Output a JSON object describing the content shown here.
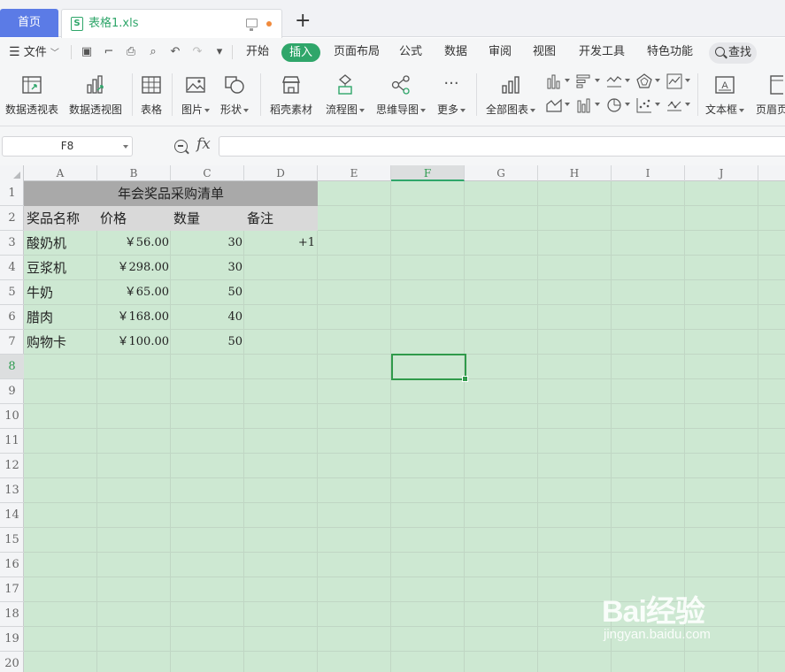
{
  "tabs": {
    "home": "首页",
    "file": "表格1.xls"
  },
  "menu": {
    "file": "文件",
    "items": [
      "开始",
      "插入",
      "页面布局",
      "公式",
      "数据",
      "审阅",
      "视图",
      "开发工具",
      "特色功能"
    ],
    "active": "插入",
    "search": "查找"
  },
  "ribbon": {
    "pivot_table": "数据透视表",
    "pivot_chart": "数据透视图",
    "table": "表格",
    "picture": "图片",
    "shape": "形状",
    "material": "稻壳素材",
    "flowchart": "流程图",
    "mindmap": "思维导图",
    "more": "更多",
    "all_charts": "全部图表",
    "textbox": "文本框",
    "header_footer": "页眉页"
  },
  "formula_bar": {
    "name_box": "F8",
    "fx": "fx",
    "value": ""
  },
  "sheet": {
    "columns": [
      "A",
      "B",
      "C",
      "D",
      "E",
      "F",
      "G",
      "H",
      "I",
      "J"
    ],
    "selected_column": "F",
    "rows": [
      "1",
      "2",
      "3",
      "4",
      "5",
      "6",
      "7",
      "8",
      "9",
      "10",
      "11",
      "12",
      "13",
      "14",
      "15",
      "16",
      "17",
      "18",
      "19",
      "20"
    ],
    "selected_row": "8",
    "title": "年会奖品采购清单",
    "headers": [
      "奖品名称",
      "价格",
      "数量",
      "备注"
    ],
    "data": [
      {
        "name": "酸奶机",
        "price": "￥56.00",
        "qty": "30",
        "note": "+1"
      },
      {
        "name": "豆浆机",
        "price": "￥298.00",
        "qty": "30",
        "note": ""
      },
      {
        "name": "牛奶",
        "price": "￥65.00",
        "qty": "50",
        "note": ""
      },
      {
        "name": "腊肉",
        "price": "￥168.00",
        "qty": "40",
        "note": ""
      },
      {
        "name": "购物卡",
        "price": "￥100.00",
        "qty": "50",
        "note": ""
      }
    ]
  },
  "colors": {
    "accent": "#2fa66a",
    "home_tab": "#5b7be6",
    "sheet_bg": "#cde8d2"
  },
  "watermark": {
    "brand": "Bai经验",
    "url": "jingyan.baidu.com"
  }
}
